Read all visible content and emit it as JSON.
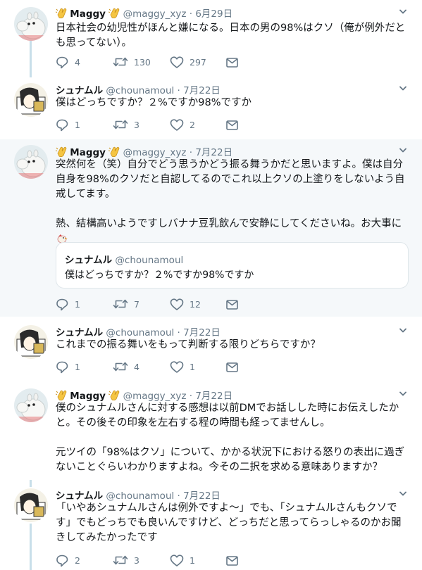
{
  "tweets": [
    {
      "author_name": "Maggy",
      "author_handle": "@maggy_xyz",
      "separator": "·",
      "date": "6月29日",
      "body": [
        "日本社会の幼児性がほんと嫌になる。日本の男の98%はクソ（俺が例外だとも思ってない）。"
      ],
      "replies": "4",
      "retweets": "130",
      "likes": "297",
      "highlighted": false
    },
    {
      "author_name": "シュナムル",
      "author_handle": "@chounamoul",
      "separator": "·",
      "date": "7月22日",
      "body": [
        "僕はどっちですか？２%ですか98%ですか"
      ],
      "replies": "1",
      "retweets": "3",
      "likes": "2",
      "highlighted": false
    },
    {
      "author_name": "Maggy",
      "author_handle": "@maggy_xyz",
      "separator": "·",
      "date": "7月22日",
      "body": [
        "突然何を（笑）自分でどう思うかどう振る舞うかだと思いますよ。僕は自分自身を98%のクソだと自認してるのでこれ以上クソの上塗りをしないよう自戒してます。",
        "熱、結構高いようですしバナナ豆乳飲んで安静にしてくださいね。お大事に"
      ],
      "quoted": {
        "author_name": "シュナムル",
        "author_handle": "@chounamoul",
        "body": "僕はどっちですか？２%ですか98%ですか"
      },
      "replies": "1",
      "retweets": "7",
      "likes": "12",
      "highlighted": true
    },
    {
      "author_name": "シュナムル",
      "author_handle": "@chounamoul",
      "separator": "·",
      "date": "7月22日",
      "body": [
        "これまでの振る舞いをもって判断する限りどちらですか？"
      ],
      "replies": "1",
      "retweets": "4",
      "likes": "1",
      "highlighted": false
    },
    {
      "author_name": "Maggy",
      "author_handle": "@maggy_xyz",
      "separator": "·",
      "date": "7月22日",
      "body": [
        "僕のシュナムルさんに対する感想は以前DMでお話しした時にお伝えしたかと。その後その印象を左右する程の時間も経ってませんし。",
        "元ツイの「98%はクソ」について、かかる状況下における怒りの表出に過ぎないことぐらいわかりますよね。今その二択を求める意味ありますか？"
      ],
      "highlighted": false
    },
    {
      "author_name": "シュナムル",
      "author_handle": "@chounamoul",
      "separator": "·",
      "date": "7月22日",
      "body": [
        "「いやあシュナムルさんは例外ですよ〜」でも、「シュナムルさんもクソです」でもどっちでも良いんですけど、どっちだと思ってらっしゃるのかお聞きしてみたかったです"
      ],
      "replies": "2",
      "retweets": "3",
      "likes": "1",
      "highlighted": false
    }
  ],
  "colors": {
    "text": "#14171a",
    "secondary": "#657786",
    "thread_line": "#c8dfe9",
    "highlight_bg": "#f5f8fa",
    "border": "#dfe6ea"
  },
  "icons": [
    "reply-icon",
    "retweet-icon",
    "like-icon",
    "dm-icon",
    "chevron-down-icon",
    "clapping-hands-icon",
    "chicken-emoji-icon"
  ]
}
